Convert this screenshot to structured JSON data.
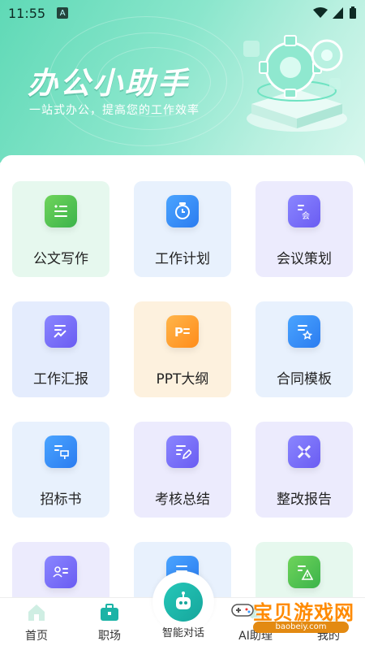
{
  "status": {
    "time": "11:55",
    "a_icon": "A"
  },
  "hero": {
    "title": "办公小助手",
    "subtitle": "一站式办公，提高您的工作效率"
  },
  "grid": {
    "items": [
      {
        "label": "公文写作",
        "icon": "document-list-icon"
      },
      {
        "label": "工作计划",
        "icon": "clock-calendar-icon"
      },
      {
        "label": "会议策划",
        "icon": "meeting-doc-icon"
      },
      {
        "label": "工作汇报",
        "icon": "chart-report-icon"
      },
      {
        "label": "PPT大纲",
        "icon": "ppt-icon"
      },
      {
        "label": "合同模板",
        "icon": "contract-star-icon"
      },
      {
        "label": "招标书",
        "icon": "bidding-doc-icon"
      },
      {
        "label": "考核总结",
        "icon": "edit-doc-icon"
      },
      {
        "label": "整改报告",
        "icon": "repair-tool-icon"
      },
      {
        "label": "",
        "icon": "profile-card-icon"
      },
      {
        "label": "",
        "icon": "list-doc-icon"
      },
      {
        "label": "",
        "icon": "warning-doc-icon"
      }
    ]
  },
  "tabbar": {
    "home": "首页",
    "work": "职场",
    "chat": "智能对话",
    "ai": "AI助理",
    "mine": "我的"
  },
  "watermark": {
    "text": "宝贝游戏网",
    "url": "baobeiy.com"
  }
}
